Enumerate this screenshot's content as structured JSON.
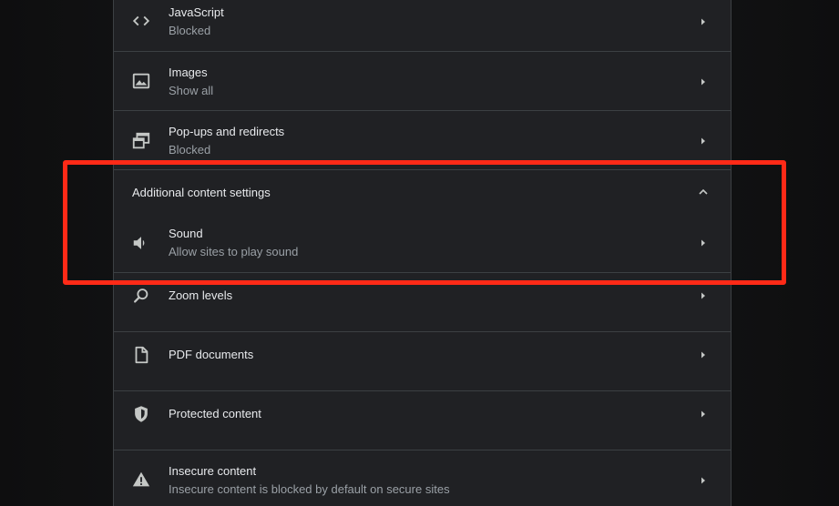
{
  "settings": {
    "items": [
      {
        "label": "JavaScript",
        "sublabel": "Blocked",
        "icon": "code-icon"
      },
      {
        "label": "Images",
        "sublabel": "Show all",
        "icon": "image-icon"
      },
      {
        "label": "Pop-ups and redirects",
        "sublabel": "Blocked",
        "icon": "popup-icon"
      }
    ],
    "additional": {
      "title": "Additional content settings",
      "items": [
        {
          "label": "Sound",
          "sublabel": "Allow sites to play sound",
          "icon": "speaker-icon"
        },
        {
          "label": "Zoom levels",
          "sublabel": "",
          "icon": "search-icon"
        },
        {
          "label": "PDF documents",
          "sublabel": "",
          "icon": "document-icon"
        },
        {
          "label": "Protected content",
          "sublabel": "",
          "icon": "shield-icon"
        },
        {
          "label": "Insecure content",
          "sublabel": "Insecure content is blocked by default on secure sites",
          "icon": "warning-icon"
        }
      ]
    }
  },
  "colors": {
    "highlight": "#ff2a17",
    "panel": "#202124",
    "text": "#e8eaed",
    "subtext": "#9aa0a6"
  }
}
